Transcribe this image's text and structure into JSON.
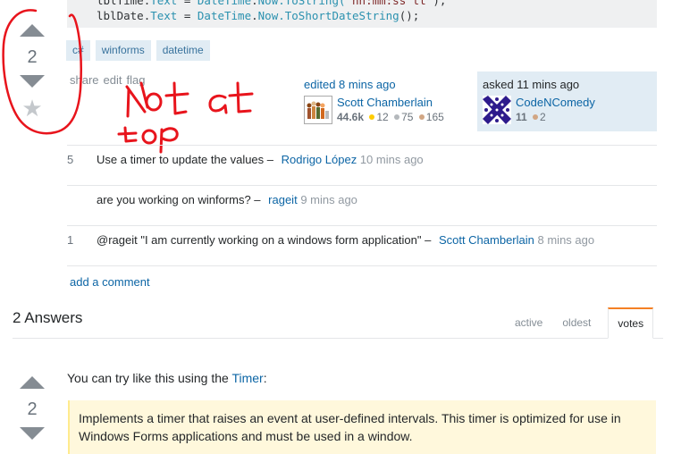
{
  "question": {
    "code_lines": [
      {
        "obj": "lblTime",
        "prop": "Text",
        "op": " = ",
        "cls": "DateTime",
        "mid": ".",
        "now": "Now",
        "call": ".ToString(",
        "arg": "\"hh:mm:ss tt\"",
        "end": ");"
      },
      {
        "obj": "lblDate",
        "prop": "Text",
        "op": " = ",
        "cls": "DateTime",
        "mid": ".",
        "now": "Now",
        "call": ".ToShortDateString",
        "arg": "",
        "end": "();"
      }
    ],
    "vote_count": "2",
    "tags": [
      "c#",
      "winforms",
      "datetime"
    ],
    "post_menu": [
      "share",
      "edit",
      "flag"
    ],
    "edited": {
      "label": "edited 8 mins ago",
      "user": "Scott Chamberlain",
      "rep": "44.6k",
      "gold": "12",
      "silver": "75",
      "bronze": "165"
    },
    "asked": {
      "label": "asked 11 mins ago",
      "user": "CodeNComedy",
      "rep": "11",
      "bronze": "2"
    }
  },
  "annotation": {
    "text_line1": "Not at",
    "text_line2": "top",
    "color": "#e8141c"
  },
  "comments": [
    {
      "score": "5",
      "text": "Use a timer to update the values –",
      "user": "Rodrigo López",
      "date": "10 mins ago"
    },
    {
      "score": "",
      "text": "are you working on winforms? –",
      "user": "rageit",
      "date": "9 mins ago"
    },
    {
      "score": "1",
      "text": "@rageit \"I am currently working on a windows form application\" –",
      "user": "Scott Chamberlain",
      "date": "8 mins ago"
    }
  ],
  "add_comment": "add a comment",
  "answers": {
    "header": "2 Answers",
    "tabs": [
      "active",
      "oldest",
      "votes"
    ],
    "selected_tab": "votes",
    "first": {
      "vote_count": "2",
      "intro": "You can try like this using the ",
      "intro_link": "Timer",
      "intro_end": ":",
      "quote": "Implements a timer that raises an event at user-defined intervals. This timer is optimized for use in Windows Forms applications and must be used in a window."
    }
  },
  "colors": {
    "link": "#0c65a5",
    "tab_accent": "#f48024",
    "gold": "#ffcc01",
    "silver": "#b4b8bc",
    "bronze": "#d1a684"
  }
}
